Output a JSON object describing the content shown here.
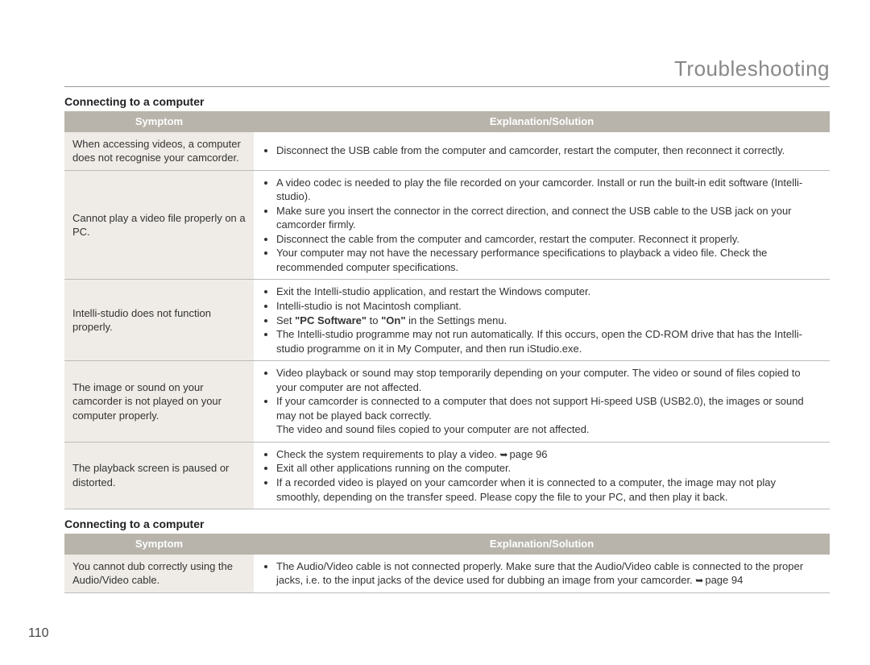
{
  "chapter_title": "Troubleshooting",
  "page_number": "110",
  "section1": {
    "heading": "Connecting to a computer",
    "col_symptom": "Symptom",
    "col_solution": "Explanation/Solution",
    "rows": {
      "r0": {
        "symptom": "When accessing videos, a computer does not recognise your camcorder.",
        "b0": "Disconnect the USB cable from the computer and camcorder, restart the computer, then reconnect it correctly."
      },
      "r1": {
        "symptom": "Cannot play a video file properly on a PC.",
        "b0": "A video codec is needed to play the file recorded on your camcorder. Install or run the built-in edit software (Intelli-studio).",
        "b1": "Make sure you insert the connector in the correct direction, and connect the USB cable to the USB jack on your camcorder firmly.",
        "b2": "Disconnect the cable from the computer and camcorder, restart the computer. Reconnect it properly.",
        "b3": "Your computer may not have the necessary performance specifications to playback a video file. Check the recommended computer specifications."
      },
      "r2": {
        "symptom": "Intelli-studio does not function properly.",
        "b0": "Exit the Intelli-studio application, and restart the Windows computer.",
        "b1": "Intelli-studio is not Macintosh compliant.",
        "b2_pre": "Set ",
        "b2_bold1": "\"PC Software\"",
        "b2_mid": " to ",
        "b2_bold2": "\"On\"",
        "b2_post": " in the Settings menu.",
        "b3": "The Intelli-studio programme may not run automatically. If this occurs, open the CD-ROM drive that has the Intelli-studio programme on it in My Computer, and then run iStudio.exe."
      },
      "r3": {
        "symptom": "The image or sound on your camcorder is not played on your computer properly.",
        "b0": "Video playback or sound may stop temporarily depending on your computer. The video or sound of files copied to your computer are not affected.",
        "b1": "If your camcorder is connected to a computer that does not support Hi-speed USB (USB2.0), the images or sound may not be played back correctly.",
        "tail": "The video and sound files copied to your computer are not affected."
      },
      "r4": {
        "symptom": "The playback screen is paused or distorted.",
        "b0_pre": "Check the system requirements to play a video. ",
        "b0_page": "page 96",
        "b1": "Exit all other applications running on the computer.",
        "b2": "If a recorded video is played on your camcorder when it is connected to a computer, the image may not play smoothly, depending on the transfer speed. Please copy the file to your PC, and then play it back."
      }
    }
  },
  "section2": {
    "heading": "Connecting to a computer",
    "col_symptom": "Symptom",
    "col_solution": "Explanation/Solution",
    "rows": {
      "r0": {
        "symptom": "You cannot dub correctly using the Audio/Video cable.",
        "b0_pre": "The Audio/Video cable is not connected properly. Make sure that the Audio/Video cable is connected to the proper jacks, i.e. to the input jacks of the device used for dubbing an image from your camcorder. ",
        "b0_page": "page 94"
      }
    }
  }
}
